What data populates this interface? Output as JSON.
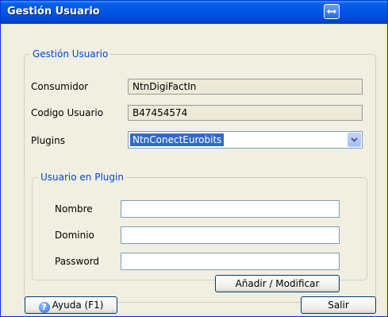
{
  "window": {
    "title": "Gestión Usuario"
  },
  "group": {
    "legend": "Gestión Usuario",
    "consumidor_label": "Consumidor",
    "consumidor_value": "NtnDigiFactIn",
    "codigo_label": "Codigo Usuario",
    "codigo_value": "B47454574",
    "plugins_label": "Plugins",
    "plugins_value": "NtnConectEurobits"
  },
  "plugin_user": {
    "legend": "Usuario en Plugin",
    "nombre_label": "Nombre",
    "nombre_value": "",
    "dominio_label": "Dominio",
    "dominio_value": "",
    "password_label": "Password",
    "password_value": "",
    "add_button": "Añadir / Modificar"
  },
  "footer": {
    "help_button": "Ayuda (F1)",
    "help_icon": "help-icon",
    "exit_button": "Salir"
  },
  "colors": {
    "title_bar": "#0055e5",
    "legend_text": "#0046d5",
    "selection": "#316ac5",
    "dialog_bg": "#f1efe2"
  }
}
